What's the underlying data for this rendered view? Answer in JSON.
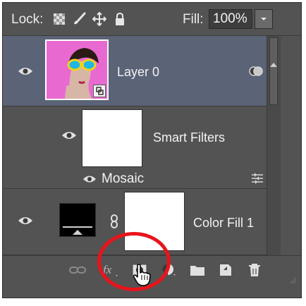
{
  "lockbar": {
    "lock_label": "Lock:",
    "fill_label": "Fill:",
    "fill_value": "100%",
    "icons": [
      "lock-transparent-pixels-icon",
      "lock-image-pixels-icon",
      "lock-position-icon",
      "lock-all-icon"
    ]
  },
  "layers": [
    {
      "name": "Layer 0",
      "selected": true,
      "type": "smart-object"
    },
    {
      "name": "Smart Filters",
      "type": "smart-filters"
    },
    {
      "name": "Color Fill 1",
      "type": "fill-layer"
    }
  ],
  "smart_filter": {
    "name": "Mosaic"
  },
  "toolbar": {
    "icons": [
      "link-layers-icon",
      "fx-icon",
      "add-layer-mask-icon",
      "adjustment-layer-icon",
      "group-folder-icon",
      "new-layer-icon",
      "trash-icon"
    ]
  },
  "colors": {
    "panel": "#535353",
    "selected_row": "#5b6377",
    "highlight": "#e8141c"
  }
}
